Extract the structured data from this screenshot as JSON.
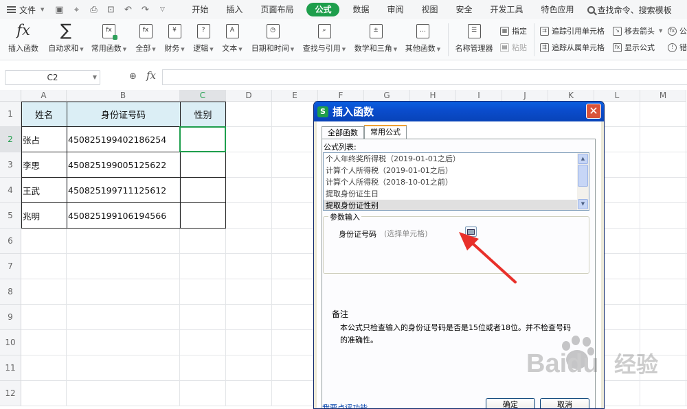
{
  "colors": {
    "accent": "#1e9e4c",
    "header_fill": "#dbeef5",
    "dialog_title": "#0a4ccc",
    "close": "#d9533a",
    "arrow": "#e8302a"
  },
  "menu": {
    "file_label": "文件",
    "tabs": [
      "开始",
      "插入",
      "页面布局",
      "公式",
      "数据",
      "审阅",
      "视图",
      "安全",
      "开发工具",
      "特色应用"
    ],
    "active_tab": "公式",
    "search_label": "查找命令、搜索模板"
  },
  "ribbon": {
    "insert_function": "插入函数",
    "autosum": "自动求和",
    "common_functions": "常用函数",
    "all": "全部",
    "finance": "财务",
    "logic": "逻辑",
    "text": "文本",
    "datetime": "日期和时间",
    "lookup": "查找与引用",
    "math": "数学和三角",
    "other": "其他函数",
    "name_manager": "名称管理器",
    "specify": "指定",
    "paste": "粘贴",
    "trace_precedents": "追踪引用单元格",
    "trace_dependents": "追踪从属单元格",
    "remove_arrows": "移去箭头",
    "show_formulas": "显示公式",
    "cut_right_1": "公",
    "cut_right_2": "错"
  },
  "formula_bar": {
    "name_box": "C2",
    "fx": "fx",
    "content": ""
  },
  "sheet": {
    "columns": [
      "A",
      "B",
      "C",
      "D",
      "E",
      "F",
      "G",
      "H",
      "I",
      "J",
      "K",
      "L",
      "M"
    ],
    "rows": [
      "1",
      "2",
      "3",
      "4",
      "5",
      "6",
      "7",
      "8",
      "9",
      "10",
      "11",
      "12"
    ],
    "selected_cell": "C2",
    "headers": [
      "姓名",
      "身份证号码",
      "性别"
    ],
    "data": [
      [
        "张占",
        "450825199402186254",
        ""
      ],
      [
        "李思",
        "450825199005125622",
        ""
      ],
      [
        "王武",
        "450825199711125612",
        ""
      ],
      [
        "兆明",
        "450825199106194566",
        ""
      ]
    ]
  },
  "dialog": {
    "title": "插入函数",
    "close_label": "✕",
    "tabs": [
      "全部函数",
      "常用公式"
    ],
    "active_tab": "常用公式",
    "list_label": "公式列表:",
    "formulas": [
      "个人年终奖所得税（2019-01-01之后）",
      "计算个人所得税（2019-01-01之后）",
      "计算个人所得税（2018-10-01之前）",
      "提取身份证生日",
      "提取身份证性别"
    ],
    "selected_formula": "提取身份证性别",
    "param_group": "参数输入",
    "param_label": "身份证号码",
    "param_placeholder": "(选择单元格)",
    "note_title": "备注",
    "note_text": "本公式只检查输入的身份证号码是否是15位或者18位。并不检查号码的准确性。",
    "feedback": "我要点评功能",
    "ok": "确定",
    "cancel": "取消"
  },
  "watermark": {
    "brand": "Baidu",
    "suffix": "经验"
  }
}
